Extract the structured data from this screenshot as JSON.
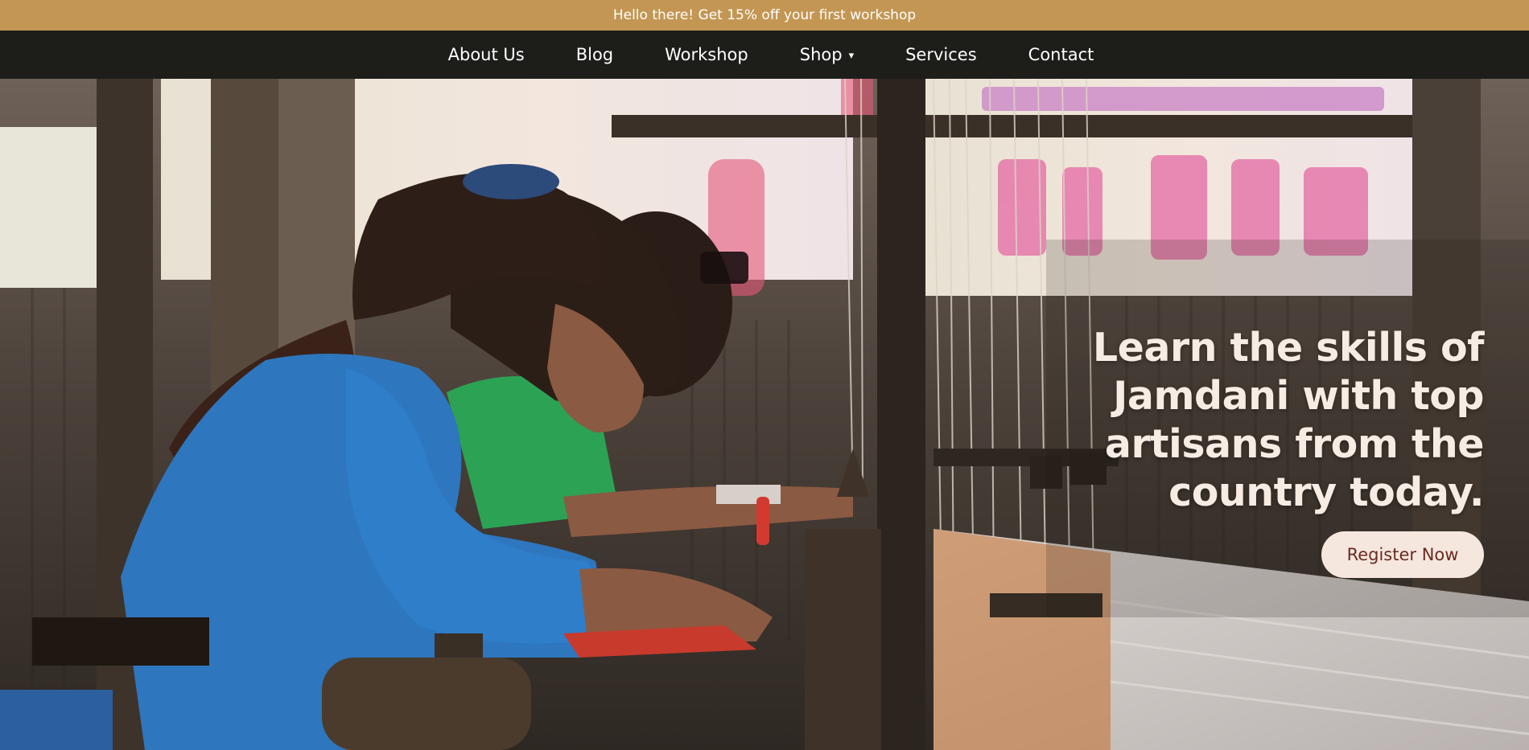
{
  "promo": {
    "text": "Hello there! Get 15% off your first workshop"
  },
  "nav": {
    "items": [
      {
        "label": "About Us"
      },
      {
        "label": "Blog"
      },
      {
        "label": "Workshop"
      },
      {
        "label": "Shop",
        "has_dropdown": true,
        "caret": "▾"
      },
      {
        "label": "Services"
      },
      {
        "label": "Contact"
      }
    ]
  },
  "hero": {
    "heading_lines": [
      "Learn the skills of",
      "Jamdani with top",
      "artisans from the",
      "country today."
    ],
    "cta_label": "Register Now",
    "image_icon": "weaving-loom-photo"
  },
  "colors": {
    "promo_bg": "#c39653",
    "nav_bg": "#1d1e1a",
    "heading_text": "#f6ece3",
    "cta_bg": "#f6e7de",
    "cta_text": "#6a2a22"
  }
}
